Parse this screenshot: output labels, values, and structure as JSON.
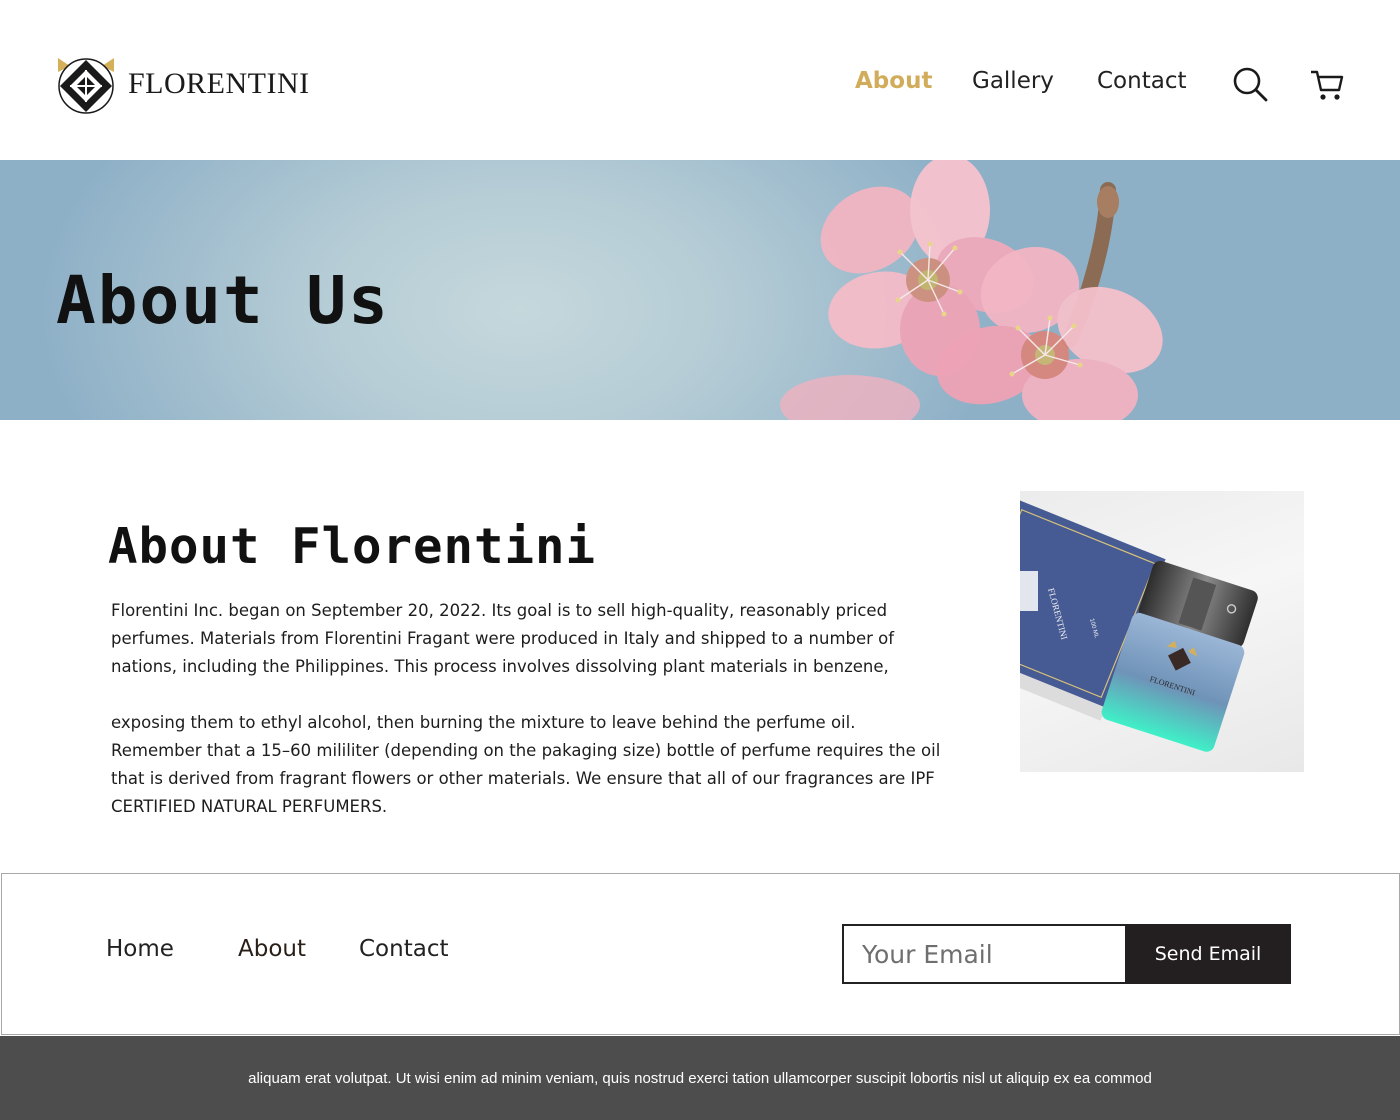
{
  "header": {
    "brand": "FLORENTINI",
    "logo_icon": "florentini-crest-icon",
    "nav": [
      {
        "label": "About",
        "active": true
      },
      {
        "label": "Gallery",
        "active": false
      },
      {
        "label": "Contact",
        "active": false
      }
    ],
    "search_icon": "search-icon",
    "cart_icon": "cart-icon",
    "active_color": "#d1ad5b"
  },
  "hero": {
    "title": "About Us",
    "image": "pink-blossom-photo"
  },
  "main": {
    "title": "About Florentini",
    "paragraphs": [
      "Florentini Inc. began on September 20, 2022. Its goal is to sell high-quality, reasonably priced perfumes. Materials from Florentini Fragant were produced in Italy and shipped to a number of nations, including the Philippines. This process involves dissolving plant materials in benzene,",
      "exposing them to ethyl alcohol, then burning the mixture to leave behind the perfume oil. Remember that a 15–60 mililiter (depending on the pakaging size) bottle of perfume requires the oil that is derived from fragrant flowers or other materials. We ensure that all of our fragrances are IPF CERTIFIED NATURAL PERFUMERS."
    ],
    "product_image": {
      "box_brand": "FLORENTINI",
      "box_size": "100 ML",
      "bottle_brand": "FLORENTINI"
    }
  },
  "footer": {
    "links": [
      "Home",
      "About",
      "Contact"
    ],
    "email_placeholder": "Your Email",
    "send_label": "Send Email",
    "bottom_text": "aliquam erat volutpat. Ut wisi enim ad minim veniam, quis nostrud exerci tation ullamcorper suscipit lobortis nisl ut aliquip ex ea commod",
    "bottom_bar_color": "#4d4d4d",
    "button_color": "#231f20"
  }
}
